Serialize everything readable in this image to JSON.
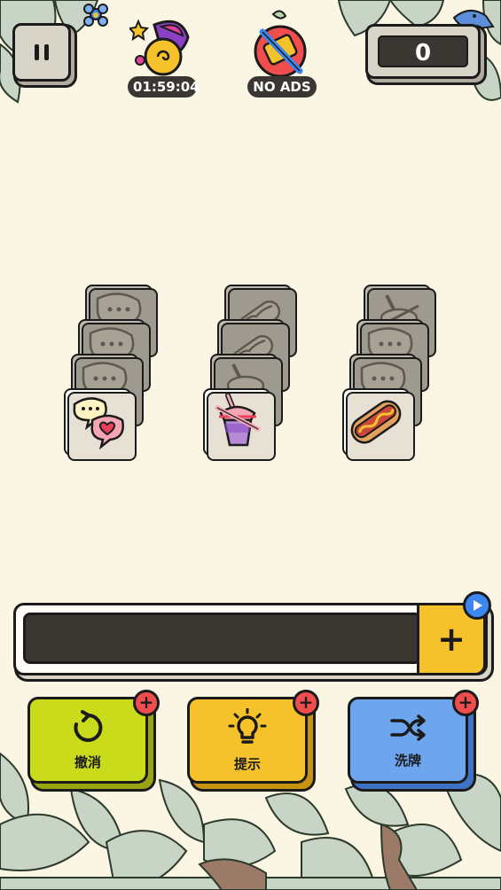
{
  "hud": {
    "timer": "01:59:04",
    "no_ads_label": "NO ADS",
    "score": "0"
  },
  "board": {
    "columns": [
      {
        "top_tile": "speech-bubble-heart-icon",
        "hidden_tiles": [
          "speech-bubble-icon",
          "speech-bubble-icon",
          "speech-bubble-icon"
        ]
      },
      {
        "top_tile": "bubble-tea-icon",
        "hidden_tiles": [
          "hot-dog-icon",
          "hot-dog-icon",
          "bubble-tea-icon"
        ]
      },
      {
        "top_tile": "hot-dog-icon",
        "hidden_tiles": [
          "bubble-tea-icon",
          "speech-bubble-icon",
          "speech-bubble-icon"
        ]
      }
    ]
  },
  "tray": {
    "add_symbol": "+",
    "video_icon": "play-icon"
  },
  "powerups": {
    "undo_label": "撤消",
    "hint_label": "提示",
    "shuffle_label": "洗牌",
    "badge_symbol": "+"
  },
  "colors": {
    "background": "#fbf5e4",
    "undo": "#c9db1b",
    "hint": "#f6c22c",
    "shuffle": "#6ea5ef",
    "badge": "#f04d4f",
    "dark": "#3a3733"
  }
}
